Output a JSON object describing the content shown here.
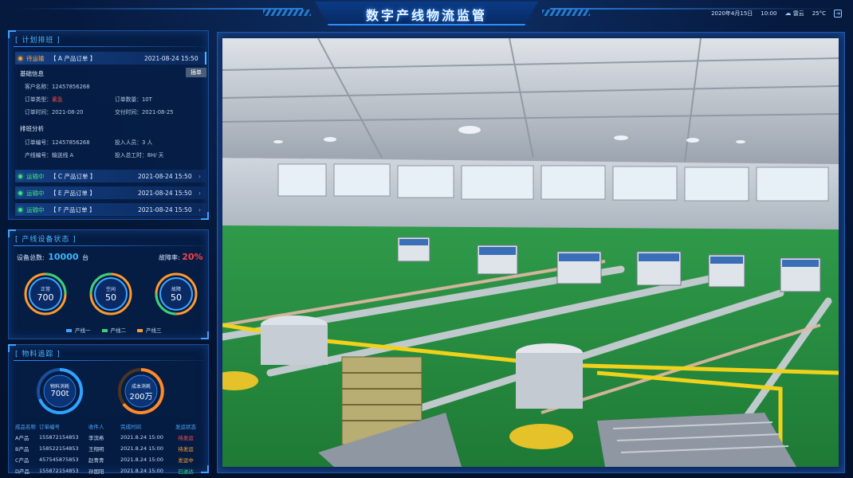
{
  "header": {
    "title": "数字产线物流监管",
    "date": "2020年4月15日",
    "time": "10:00",
    "weather": "雷云",
    "temperature": "25°C"
  },
  "plan": {
    "title": "[ 计划排班 ]",
    "active_order": {
      "status": "待运输",
      "name": "【 A 产品订单 】",
      "time": "2021-08-24  15:50"
    },
    "basic_info_label": "基础信息",
    "insert_button": "插单",
    "customer_name": "客户名称：12457856268",
    "order_type_label": "订单类型：",
    "order_type_value": "紧急",
    "order_qty": "订单数量：10T",
    "order_time": "订单时间：2021-08-20",
    "delivery_time": "交付时间：2021-08-25",
    "schedule_label": "排班分析",
    "order_no": "订单编号：12457856268",
    "staff": "投入人员：3 人",
    "line_no": "产线编号：输送线 A",
    "work_hours": "投入总工时：8H/ 天",
    "orders": [
      {
        "status": "运输中",
        "name": "【 C 产品订单 】",
        "time": "2021-08-24  15:50"
      },
      {
        "status": "运输中",
        "name": "【 E 产品订单 】",
        "time": "2021-08-24  15:50"
      },
      {
        "status": "运输中",
        "name": "【 F 产品订单 】",
        "time": "2021-08-24  15:50"
      }
    ]
  },
  "equipment": {
    "title": "[ 产线设备状态 ]",
    "total_label": "设备总数:",
    "total_value": "10000",
    "total_unit": "台",
    "fault_label": "故障率:",
    "fault_value": "20%",
    "gauges": [
      {
        "label": "正常",
        "value": "700",
        "color": "#3ea6ff"
      },
      {
        "label": "空闲",
        "value": "50",
        "color": "#38d27a"
      },
      {
        "label": "故障",
        "value": "50",
        "color": "#ff9a2e"
      }
    ],
    "legend": [
      {
        "name": "产线一",
        "color": "#3ea6ff"
      },
      {
        "name": "产线二",
        "color": "#38d27a"
      },
      {
        "name": "产线三",
        "color": "#ff9a2e"
      }
    ]
  },
  "material": {
    "title": "[ 物料追踪 ]",
    "gauge1": {
      "label": "物料消耗",
      "value": "700t"
    },
    "gauge2": {
      "label": "成本消耗",
      "value": "200万"
    },
    "columns": [
      "成品名称",
      "订单编号",
      "收件人",
      "完成时间",
      "发运状态"
    ],
    "rows": [
      {
        "name": "A产品",
        "order": "155872154853",
        "recipient": "李滨希",
        "time": "2021.8.24  15:00",
        "status": "待发运",
        "status_class": "s-red"
      },
      {
        "name": "B产品",
        "order": "158522154853",
        "recipient": "王翔明",
        "time": "2021.8.24  15:00",
        "status": "待发运",
        "status_class": "s-orange"
      },
      {
        "name": "C产品",
        "order": "457545875853",
        "recipient": "赵青青",
        "time": "2021.8.24  15:00",
        "status": "发运中",
        "status_class": "s-orange"
      },
      {
        "name": "D产品",
        "order": "155872154853",
        "recipient": "孙国阳",
        "time": "2021.8.24  15:00",
        "status": "已送达",
        "status_class": "s-green"
      }
    ]
  }
}
